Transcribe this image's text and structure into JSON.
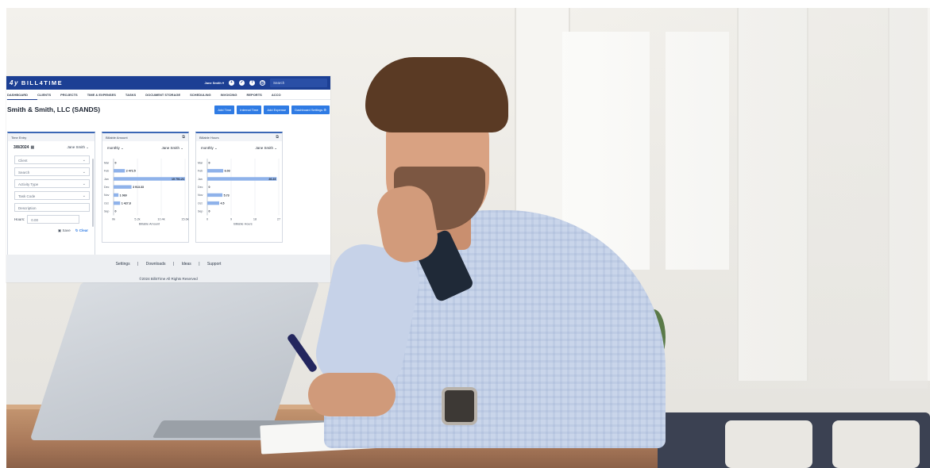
{
  "brand": {
    "logo_text": "BILL4TIME",
    "logo_mark": "4y"
  },
  "topbar": {
    "user_menu": "Jane Smith ▾",
    "search_placeholder": "Search"
  },
  "nav": [
    "DASHBOARD",
    "CLIENTS",
    "PROJECTS",
    "TIME & EXPENSES",
    "TASKS",
    "DOCUMENT STORAGE",
    "SCHEDULING",
    "INVOICING",
    "REPORTS",
    "ACCO"
  ],
  "page": {
    "title": "Smith & Smith, LLC (SANDS)"
  },
  "actions": [
    "Add Time",
    "Internal Time",
    "Add Expense",
    "Dashboard Settings ⚙"
  ],
  "time_entry": {
    "title": "Time Entry",
    "date": "3/8/2024",
    "user": "Jane Smith",
    "fields": [
      "Client",
      "Search",
      "Activity Type",
      "Task Code"
    ],
    "description_placeholder": "Description",
    "hours_label": "Hours:",
    "hours_value": "0.00",
    "save_label": "Save",
    "clear_label": "Clear"
  },
  "billable_amount": {
    "title": "Billable Amount",
    "period": "monthly",
    "user": "Jane Smith",
    "axis_label": "Billable Amount"
  },
  "billable_hours": {
    "title": "Billable Hours",
    "period": "monthly",
    "user": "Jane Smith",
    "axis_label": "Billable Hours"
  },
  "chart_data": [
    {
      "type": "bar",
      "orientation": "horizontal",
      "categories": [
        "Mar",
        "Feb",
        "Jan",
        "Dec",
        "Nov",
        "Oct",
        "Sep"
      ],
      "values": [
        0,
        2472.5,
        15751.21,
        3913.33,
        1069,
        1427.8,
        0
      ],
      "data_labels": [
        "0",
        "2 472.5",
        "15 751.21",
        "3 913.33",
        "1 069",
        "1 427.8",
        "0"
      ],
      "xticks": [
        "0k",
        "5.2k",
        "10.4k",
        "15.6k"
      ],
      "xlabel": "Billable Amount",
      "xlim": [
        0,
        15600
      ],
      "grid": true
    },
    {
      "type": "bar",
      "orientation": "horizontal",
      "categories": [
        "Mar",
        "Feb",
        "Jan",
        "Dec",
        "Nov",
        "Oct",
        "Sep"
      ],
      "values": [
        0,
        6.03,
        26.23,
        0,
        5.73,
        4.5,
        0
      ],
      "data_labels": [
        "0",
        "6.03",
        "26.23",
        "0",
        "5.73",
        "4.5",
        "0"
      ],
      "xticks": [
        "0",
        "9",
        "18",
        "27"
      ],
      "xlabel": "Billable Hours",
      "xlim": [
        0,
        27
      ],
      "grid": true
    }
  ],
  "footer": {
    "links": [
      "Settings",
      "Downloads",
      "Ideas",
      "Support"
    ],
    "separator": "|",
    "copyright": "©2024 Bill4Time All Rights Reserved"
  },
  "colors": {
    "brand": "#1c3f94",
    "button": "#2f7be4",
    "bar": "#8fb2ea"
  }
}
